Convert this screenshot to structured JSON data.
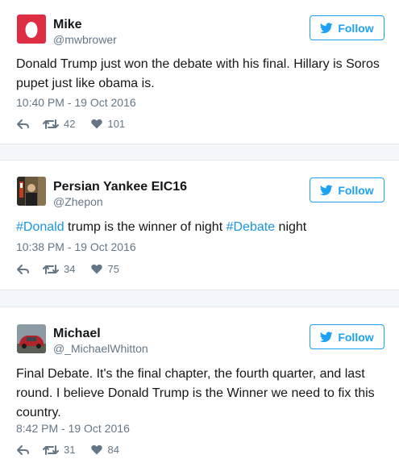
{
  "tweets": [
    {
      "name": "Mike",
      "handle": "@mwbrower",
      "follow_label": "Follow",
      "text_parts": [
        {
          "t": "Donald Trump just won the debate with his final. Hillary is Soros pupet just like obama is."
        }
      ],
      "time": "10:40 PM - 19 Oct 2016",
      "retweets": "42",
      "likes": "101",
      "avatar": "egg-avatar"
    },
    {
      "name": "Persian Yankee EIC16",
      "handle": "@Zhepon",
      "follow_label": "Follow",
      "text_parts": [
        {
          "t": "#Donald",
          "hashtag": true
        },
        {
          "t": " trump is the winner of night "
        },
        {
          "t": "#Debate",
          "hashtag": true
        },
        {
          "t": " night"
        }
      ],
      "time": "10:38 PM - 19 Oct 2016",
      "retweets": "34",
      "likes": "75",
      "avatar": "photo-avatar"
    },
    {
      "name": "Michael",
      "handle": "@_MichaelWhitton",
      "follow_label": "Follow",
      "text_parts": [
        {
          "t": "Final Debate. It's the final chapter, the fourth quarter, and last round. I believe Donald Trump is the Winner we need to fix this country."
        }
      ],
      "time": "8:42 PM - 19 Oct 2016",
      "retweets": "31",
      "likes": "84",
      "avatar": "car-photo-avatar"
    }
  ],
  "colors": {
    "accent": "#1da1f2",
    "hashtag": "#1b95e0",
    "muted": "#657786",
    "egg_bg": "#dd2e44"
  }
}
